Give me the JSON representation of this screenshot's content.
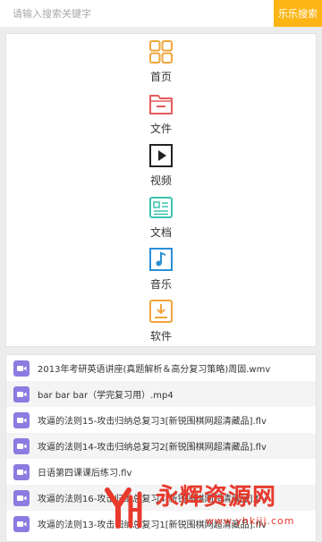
{
  "search": {
    "placeholder": "请输入搜索关键字",
    "button_label": "乐乐搜索"
  },
  "categories": [
    {
      "label": "首页",
      "icon": "grid-icon",
      "color": "#f0a63a"
    },
    {
      "label": "文件",
      "icon": "folder-icon",
      "color": "#e55b5b"
    },
    {
      "label": "视频",
      "icon": "play-icon",
      "color": "#222222"
    },
    {
      "label": "文档",
      "icon": "document-icon",
      "color": "#3cc2ad"
    },
    {
      "label": "音乐",
      "icon": "music-icon",
      "color": "#2a8fd6"
    },
    {
      "label": "软件",
      "icon": "download-icon",
      "color": "#f0a63a"
    }
  ],
  "files": [
    {
      "name": "2013年考研英语讲座(真题解析＆高分复习策略)周固.wmv",
      "icon": "video-file-icon"
    },
    {
      "name": "bar bar bar（学完复习用）.mp4",
      "icon": "video-file-icon"
    },
    {
      "name": "攻逼的法则15-攻击归纳总复习3[新锐围棋网超清藏品].flv",
      "icon": "video-file-icon"
    },
    {
      "name": "攻逼的法则14-攻击归纳总复习2[新锐围棋网超清藏品].flv",
      "icon": "video-file-icon"
    },
    {
      "name": "日语第四课课后练习.flv",
      "icon": "video-file-icon"
    },
    {
      "name": "攻逼的法则16-攻击归纳总复习4[新锐围棋网超清藏品].flv",
      "icon": "video-file-icon"
    },
    {
      "name": "攻逼的法则13-攻击归纳总复习1[新锐围棋网超清藏品].flv",
      "icon": "video-file-icon"
    }
  ],
  "watermark": {
    "title": "永辉资源网",
    "url": "www.yhkjjj.com"
  },
  "colors": {
    "accent": "#fcb515",
    "file_icon": "#8c7be0",
    "watermark": "#e8392c"
  }
}
